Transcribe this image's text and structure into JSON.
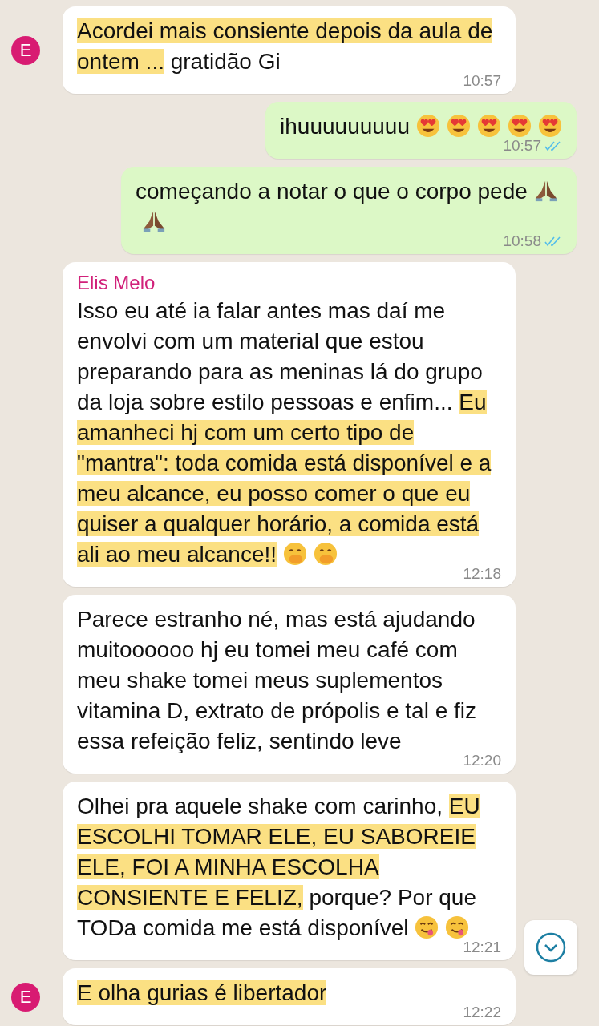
{
  "messages": [
    {
      "kind": "incoming",
      "avatar": "E",
      "segments": [
        {
          "text": "Acordei mais consiente depois da aula de ontem ...",
          "highlighted": true
        },
        {
          "text": " gratidão Gi",
          "highlighted": false
        }
      ],
      "time": "10:57"
    },
    {
      "kind": "outgoing",
      "segments": [
        {
          "text": "ihuuuuuuuuu",
          "highlighted": false
        }
      ],
      "emojis": [
        {
          "kind": "heart-eyes"
        },
        {
          "kind": "heart-eyes"
        },
        {
          "kind": "heart-eyes"
        },
        {
          "kind": "heart-eyes"
        },
        {
          "kind": "heart-eyes"
        }
      ],
      "time": "10:57",
      "read": true
    },
    {
      "kind": "outgoing",
      "segments": [
        {
          "text": "começando a notar o que o corpo pede",
          "highlighted": false
        }
      ],
      "emojis": [
        {
          "kind": "praying-hands"
        },
        {
          "kind": "praying-hands"
        }
      ],
      "time": "10:58",
      "read": true
    },
    {
      "kind": "incoming",
      "sender": "Elis Melo",
      "segments": [
        {
          "text": "Isso eu até ia falar antes mas daí me envolvi com um material que estou preparando para as meninas lá do grupo da loja sobre estilo pessoas e enfim... ",
          "highlighted": false
        },
        {
          "text": "Eu amanheci hj com um certo tipo de \"mantra\": toda comida está disponível e a meu alcance, eu posso comer o que eu quiser a qualquer horário, a comida está ali ao meu alcance!!",
          "highlighted": true
        }
      ],
      "emojis": [
        {
          "kind": "hand-over-mouth"
        },
        {
          "kind": "hand-over-mouth"
        }
      ],
      "time": "12:18"
    },
    {
      "kind": "incoming",
      "segments": [
        {
          "text": "Parece estranho né, mas está ajudando muitoooooo hj eu tomei meu café com meu shake tomei meus suplementos vitamina D, extrato de própolis e tal e fiz essa refeição feliz, sentindo leve",
          "highlighted": false
        }
      ],
      "time": "12:20"
    },
    {
      "kind": "incoming",
      "segments": [
        {
          "text": "Olhei pra aquele shake com carinho, ",
          "highlighted": false
        },
        {
          "text": "EU ESCOLHI TOMAR ELE, EU SABOREIE ELE, FOI A MINHA ESCOLHA CONSIENTE E FELIZ,",
          "highlighted": true
        },
        {
          "text": " porque? Por que TODa comida me está disponível",
          "highlighted": false
        }
      ],
      "emojis": [
        {
          "kind": "yum"
        },
        {
          "kind": "yum"
        }
      ],
      "time": "12:21"
    },
    {
      "kind": "incoming",
      "avatar": "E",
      "segments": [
        {
          "text": "E olha gurias é libertador",
          "highlighted": true
        }
      ],
      "time": "12:22"
    }
  ]
}
